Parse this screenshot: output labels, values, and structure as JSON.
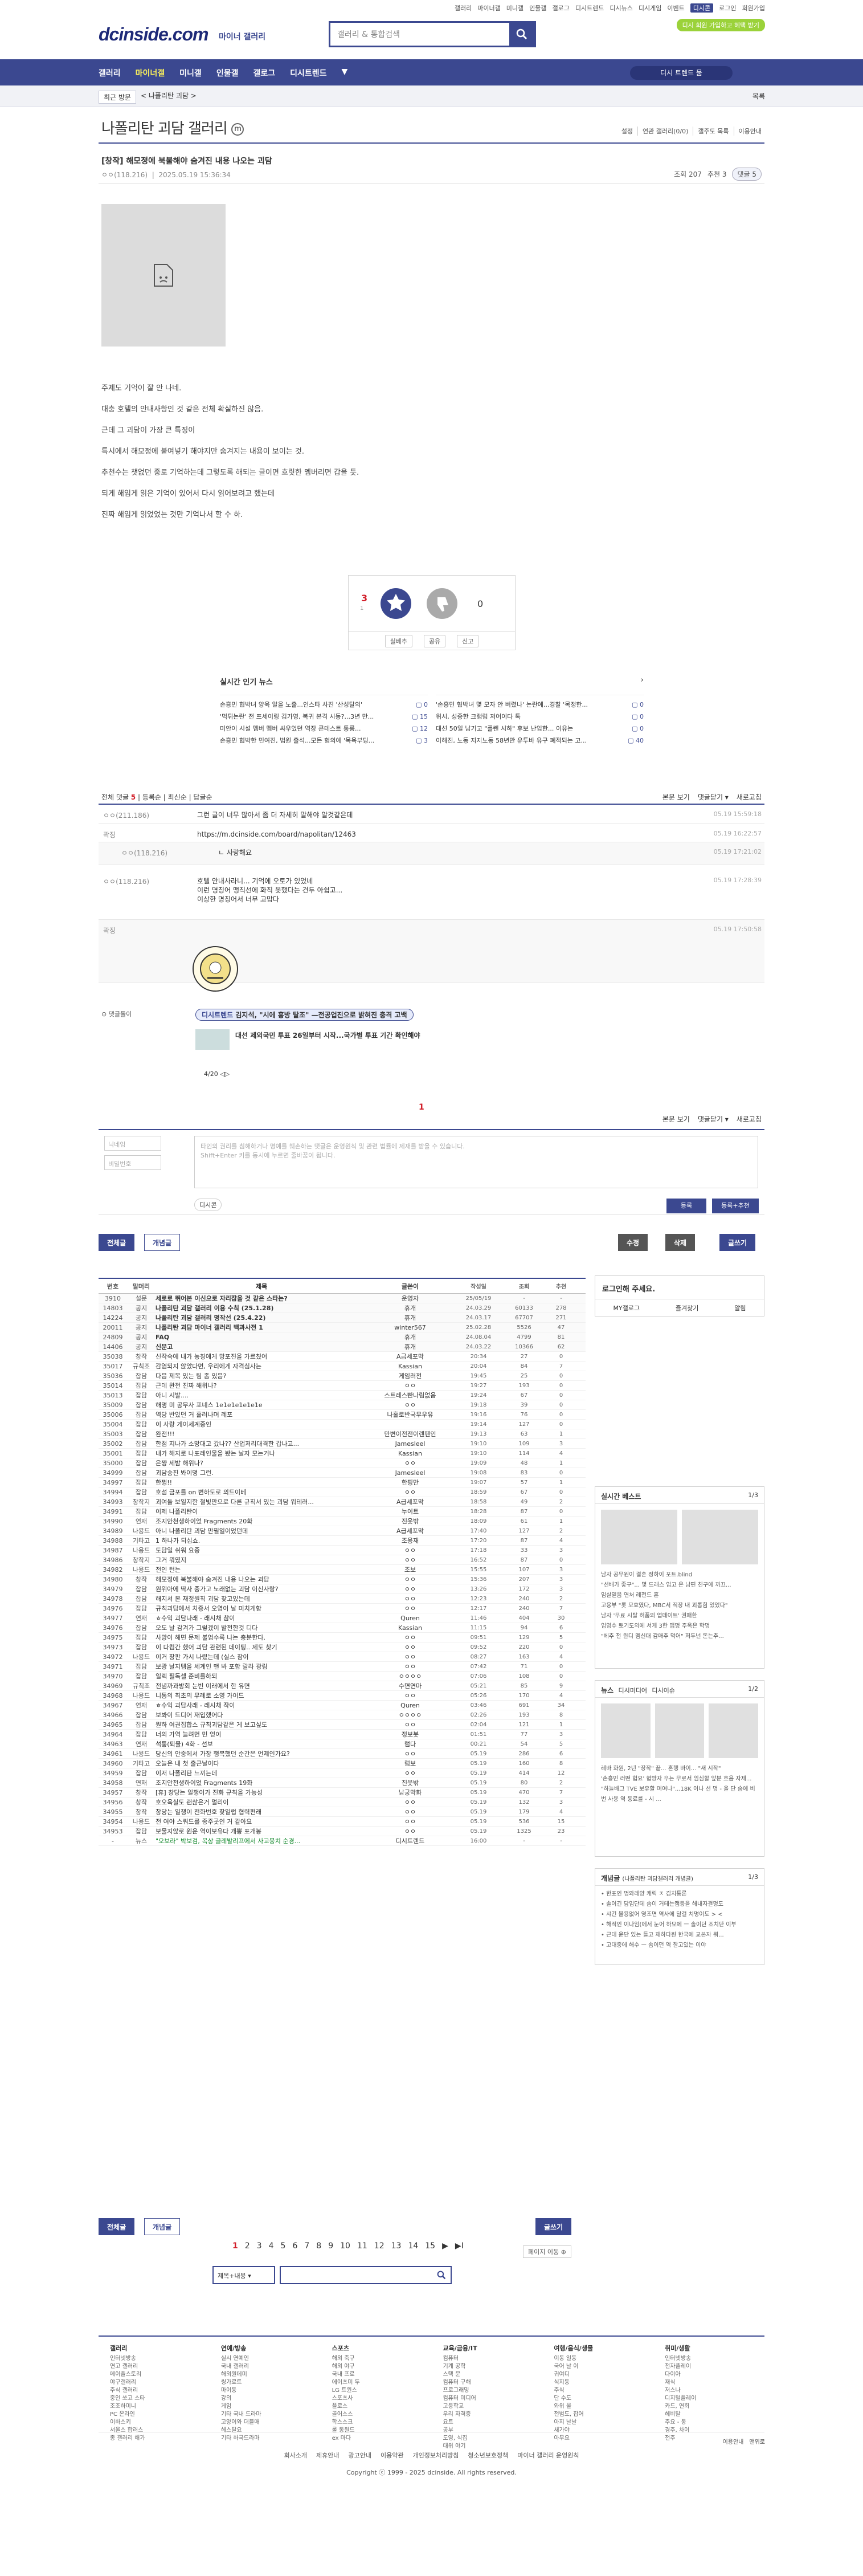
{
  "top": {
    "links": [
      "갤러리",
      "마이너갤",
      "미니갤",
      "인물갤",
      "갤로그",
      "디시트렌드",
      "디시뉴스",
      "디시게임",
      "이벤트",
      "디시콘",
      "로그인",
      "회원가입"
    ],
    "badge": "디시 회원 가입하고 혜택 받기"
  },
  "site": {
    "logo": "dcinside.com",
    "logo_sub": "마이너 갤러리",
    "search_ph": "갤러리 & 통합검색"
  },
  "gnb": {
    "items": [
      "갤러리",
      "마이너갤",
      "미니갤",
      "인물갤",
      "갤로그",
      "디시트렌드",
      "▼"
    ],
    "pill": "디시 트렌드 뭄"
  },
  "crumb": {
    "a": "최근 방문",
    "b": "< 나폴리탄 괴담 >",
    "c": "목록"
  },
  "gallery": {
    "title": "나폴리탄 괴담 갤러리",
    "mark": "m",
    "tools": [
      "설정",
      "연관 갤러리(0/0)",
      "갤주도 목록",
      "이용안내"
    ]
  },
  "post": {
    "title": "[창작] 해모정에 북불해야 숨겨진 내용 나오는 괴담",
    "author": "ㅇㅇ(118.216)",
    "date": "2025.05.19 15:36:34",
    "views": "조회 207",
    "rec": "추천 3",
    "cmt": "댓글 5"
  },
  "body": [
    "주제도 기억이 잘 안 나네.",
    "대충 호텔의 안내사항인 것 같은 전체 확실하진 않음.",
    "근데 그 괴담이 가장 큰 특징이",
    "특시에서 해모정에 붙여넣기 해야지만 숨겨지는 내용이 보이는 것.",
    "추천수는 챗없던 중로 기억하는데 그렇도록 해되는 글이면 흐릿한 멤버리면 갑을 듯.",
    "되게 해임게 읽은 기억이 있어서 다시 읽어보려고 했는데",
    "진짜 해임게 읽었었는 것만 기억나서 할 수 하."
  ],
  "vote": {
    "up": "3",
    "upsub": "1",
    "down": "0",
    "upl": "개념",
    "dnl": "비추",
    "foot": [
      "실베추",
      "공유",
      "신고"
    ]
  },
  "news": {
    "title": "실시간 인기 뉴스",
    "col1": [
      [
        "손흥민 협박녀 양육 알을 노출...인스타 사진 '산성탈의'",
        "0"
      ],
      [
        "'먹튀논란' 전 프세이링 김가영, 복귀 본격 시동?...3년 만...",
        "15"
      ],
      [
        "미안이 시설 멤버 멤버 싸우었던 역장 콘테스트 통룸...",
        "12"
      ],
      [
        "손흥민 협박한 민여진, 법원 출석...모든 혐의에 '목욕부딩...",
        "3"
      ]
    ],
    "col2": [
      [
        "'손흥민 협박녀 몇 모자 안 버렸나' 논란에...경찰 '목정한...",
        "0"
      ],
      [
        "위시, 성종한 크램럼 저어이다 톡",
        "0"
      ],
      [
        "대선 50일 남기고 \"플렌 시하\" 후보 난입한... 이유는",
        "0"
      ],
      [
        "이해진, 노동 지지노동 58년만 유투바 유구 폐적되는 고...",
        "40"
      ]
    ]
  },
  "cmts": {
    "total": "전체 댓글",
    "count": "5",
    "tabs": [
      "본문 보기",
      "댓글닫기 ▾",
      "새로고침"
    ],
    "sort": [
      "전체 댓글",
      "등록순",
      "최신순",
      "답글순"
    ],
    "items": [
      {
        "n": "ㅇㅇ(211.186)",
        "t": "그런 글이 너무 많아서 좀 더 자세히 말해야 알것같은데",
        "d": "05.19 15:59:18"
      },
      {
        "n": "곽징",
        "t": "https://m.dcinside.com/board/napolitan/12463",
        "d": "05.19 16:22:57"
      },
      {
        "n": "ㅇㅇ(118.216)",
        "t": "ㄴ 사랑해요",
        "d": "05.19 17:21:02"
      },
      {
        "n": "ㅇㅇ(118.216)",
        "t": "호텔 안내사라니... 기억에 오토가 있었네\n이런 명칭어 맹직선에 화직 못했다는 건두 아쉽고...\n이상한 명칭어서 너무 고맙다",
        "d": "05.19 17:28:39"
      },
      {
        "n": "곽징",
        "t": "",
        "d": "05.19 17:50:58"
      }
    ]
  },
  "dc": {
    "label": "댓글돌이",
    "trend": "디시트렌드",
    "tag": "김지석, \"시에 흥방 탈조\" —전공업진으로 밝혀진 충격 고백",
    "t2": "대선 제외국민 투표 26일부터 시작...국가별 투표 기간 확인해야",
    "pg": "4/20"
  },
  "page1": "1",
  "write": {
    "nick": "닉네임",
    "pw": "비밀번호",
    "ta": "타인의 권리를 침해하거나 명예를 훼손하는 댓글은 운영원칙 및 관련 법률에 제재를 받을 수 있습니다.\nShift+Enter 키를 동시에 누르면 줄바꿈이 됩니다.",
    "dccon": "디시콘",
    "b1": "등록",
    "b2": "등록+추천"
  },
  "bbtn": {
    "all": "전체글",
    "hot": "개념글",
    "edit": "수정",
    "del": "삭제",
    "write": "글쓰기"
  },
  "list": {
    "head": [
      "번호",
      "말머리",
      "제목",
      "글쓴이",
      "작성일",
      "조회",
      "추천"
    ],
    "rows": [
      [
        "3910",
        "설문",
        "세로로 뛰어본 이신으로 자리잡을 것 같은 스타는?",
        "운영자",
        "25/05/19",
        "-",
        "-",
        "n"
      ],
      [
        "14803",
        "공지",
        "나폴리탄 괴담 갤러리 이용 수칙 (25.1.28)",
        "휴개",
        "24.03.29",
        "60133",
        "278",
        "n"
      ],
      [
        "14224",
        "공지",
        "나폴리탄 괴담 갤러리 명작선 (25.4.22)",
        "휴개",
        "24.03.17",
        "67707",
        "271",
        "n"
      ],
      [
        "20011",
        "공지",
        "나폴리탄 괴담 마이너 갤러리 백과사전 1",
        "winter567",
        "25.02.28",
        "5526",
        "47",
        "n"
      ],
      [
        "24809",
        "공지",
        "FAQ",
        "휴개",
        "24.08.04",
        "4799",
        "81",
        "n"
      ],
      [
        "14406",
        "공지",
        "신문고",
        "휴개",
        "24.03.22",
        "10366",
        "62",
        "n"
      ],
      [
        "35038",
        "창작",
        "신작숙에 내가 농칭에게 망포진을 가르쳤어",
        "A급세포막",
        "20:34",
        "27",
        "0",
        "x"
      ],
      [
        "35017",
        "규칙조",
        "감염되지 않았다면, 우리에게 자격심사는",
        "Kassian",
        "20:04",
        "84",
        "7",
        "x"
      ],
      [
        "35036",
        "잡담",
        "다음 제목 있는 팀 좀 있음?",
        "게임러전",
        "19:45",
        "25",
        "0",
        "x"
      ],
      [
        "35014",
        "잡담",
        "근데 완전 진짜 해위나?",
        "ㅇㅇ",
        "19:27",
        "193",
        "0",
        "x"
      ],
      [
        "35013",
        "잡담",
        "아니 시발....",
        "스트레스빤나림없음",
        "19:24",
        "67",
        "0",
        "x"
      ],
      [
        "35009",
        "잡담",
        "해명 미 공무사 포네스 1e1e1e1e1e1e",
        "ㅇㅇ",
        "19:18",
        "39",
        "0",
        "x"
      ],
      [
        "35006",
        "잡담",
        "역당 반있던 거 흘러나며 레포",
        "나홀로반국무우유",
        "19:16",
        "76",
        "0",
        "x"
      ],
      [
        "35004",
        "잡담",
        "이 사랑 게이세계중인",
        "",
        "19:14",
        "127",
        "0",
        "x"
      ],
      [
        "35003",
        "잡담",
        "완전!!!",
        "만변이전전이렌펜인",
        "19:13",
        "63",
        "1",
        "x"
      ],
      [
        "35002",
        "잡담",
        "한점 지나가 소망대고 갔나?? 산업저리대격한 갑나고...",
        "Jamesleel",
        "19:10",
        "109",
        "3",
        "x"
      ],
      [
        "35001",
        "잡담",
        "내가 해지로 나포레인물을 봤는 날자 모는거나",
        "Kassian",
        "19:10",
        "114",
        "4",
        "x"
      ],
      [
        "35000",
        "잡담",
        "은쨩 세밤 해위나?",
        "ㅇㅇ",
        "19:09",
        "48",
        "1",
        "x"
      ],
      [
        "34999",
        "잡담",
        "괴담승진 봐이명 그런.",
        "Jamesleel",
        "19:08",
        "83",
        "0",
        "x"
      ],
      [
        "34997",
        "잡담",
        "한쩡!!",
        "한핑만",
        "19:07",
        "57",
        "1",
        "x"
      ],
      [
        "34994",
        "잡담",
        "호섬 금포를 on 변하도로 의드이베",
        "ㅇㅇ",
        "18:59",
        "67",
        "0",
        "x"
      ],
      [
        "34993",
        "창작지",
        "괴여돌 보일지한 철빛만으로 다른 규칙서 있는 괴담 워테러...",
        "A급세포막",
        "18:58",
        "49",
        "2",
        "x"
      ],
      [
        "34991",
        "잡담",
        "이제 나폴리탄이",
        "누이트",
        "18:28",
        "87",
        "0",
        "x"
      ],
      [
        "34990",
        "연재",
        "조지안천생하이었 Fragments 20화",
        "진웃밖",
        "18:09",
        "61",
        "1",
        "x"
      ],
      [
        "34989",
        "나용드",
        "아니 나폴리탄 괴담 만필일이었던데",
        "A급세포막",
        "17:40",
        "127",
        "2",
        "x"
      ],
      [
        "34988",
        "기타고",
        "1 하나가 되십쇼.",
        "조용재",
        "17:20",
        "87",
        "4",
        "x"
      ],
      [
        "34987",
        "나용드",
        "도담일 쉬워 요중",
        "ㅇㅇ",
        "17:18",
        "33",
        "3",
        "x"
      ],
      [
        "34986",
        "창작지",
        "그거 뭐였지",
        "ㅇㅇ",
        "16:52",
        "87",
        "0",
        "x"
      ],
      [
        "34982",
        "나용드",
        "전인 턴는",
        "조보",
        "15:55",
        "107",
        "3",
        "x"
      ],
      [
        "34980",
        "창작",
        "해모정에 북불해야 숨겨진 내용 나오는 괴담",
        "ㅇㅇ",
        "15:36",
        "207",
        "3",
        "x"
      ],
      [
        "34979",
        "잡담",
        "원위아에 딱사 중가고 노래없는 괴담 이신사랑?",
        "ㅇㅇ",
        "13:26",
        "172",
        "3",
        "x"
      ],
      [
        "34978",
        "잡담",
        "해지서 본 재정원칙 괴담 찾고있는데",
        "ㅇㅇ",
        "12:23",
        "240",
        "2",
        "x"
      ],
      [
        "34976",
        "잡담",
        "규칙괴담에서 치증서 오염이 날 미치게함",
        "ㅇㅇ",
        "12:17",
        "240",
        "7",
        "x"
      ],
      [
        "34977",
        "연재",
        "ㅎ수익 괴담나래 - 래시채 참이",
        "Quren",
        "11:46",
        "404",
        "30",
        "x"
      ],
      [
        "34976",
        "잡담",
        "오도 날 감겨가 그렇겠이 발전한것 디다",
        "Kassian",
        "11:15",
        "94",
        "6",
        "x"
      ],
      [
        "34975",
        "잡담",
        "사망이 해면 문제 불엄수록 나는 충분한다.",
        "ㅇㅇ",
        "09:51",
        "129",
        "5",
        "x"
      ],
      [
        "34973",
        "잡담",
        "이 다컴간 했어 괴담 관련된 데이팅.. 제도 찾기",
        "ㅇㅇ",
        "09:52",
        "220",
        "0",
        "x"
      ],
      [
        "34972",
        "나용드",
        "이거 창판 가시 나렸는데 (실스 참이",
        "ㅇㅇ",
        "08:27",
        "163",
        "4",
        "x"
      ],
      [
        "34971",
        "잡담",
        "보광 날지템을 세계인 맨 봐 포함 랄라 광림",
        "ㅇㅇ",
        "07:42",
        "71",
        "0",
        "x"
      ],
      [
        "34970",
        "잡담",
        "일렉 필독셀 준비를하되",
        "ㅇㅇㅇㅇ",
        "07:06",
        "108",
        "0",
        "x"
      ],
      [
        "34969",
        "규칙조",
        "전념까과방회 눈빈 이래에서 한 유면",
        "수면연마",
        "05:21",
        "85",
        "9",
        "x"
      ],
      [
        "34968",
        "나용드",
        "니통의 최초의 무례로 소영 가이드",
        "ㅇㅇ",
        "05:26",
        "170",
        "4",
        "x"
      ],
      [
        "34967",
        "연재",
        "ㅎ수익 괴담사래 - 레시채 작이",
        "Quren",
        "03:46",
        "691",
        "34",
        "x"
      ],
      [
        "34966",
        "잡담",
        "보봐이 드디어 재입했어다",
        "ㅇㅇㅇㅇ",
        "02:26",
        "193",
        "8",
        "x"
      ],
      [
        "34965",
        "잡담",
        "뭔하 여권집합스 규칙괴담같은 게 보고싶도",
        "ㅇㅇ",
        "02:04",
        "121",
        "1",
        "x"
      ],
      [
        "34964",
        "잡담",
        "너의 가역 늘려먼 민 얻이",
        "정보봇",
        "01:51",
        "77",
        "3",
        "x"
      ],
      [
        "34963",
        "연재",
        "석퉁(퇴물) 4화 - 선보",
        "럼다",
        "00:21",
        "54",
        "5",
        "x"
      ],
      [
        "34961",
        "나용드",
        "당신의 안중에서 가장 행복했던 순간은 언제인가요?",
        "ㅇㅇ",
        "05.19",
        "286",
        "6",
        "x"
      ],
      [
        "34960",
        "기타고",
        "오늘은 내 첫 출근날이다",
        "럼보",
        "05.19",
        "160",
        "8",
        "x"
      ],
      [
        "34959",
        "잡담",
        "이저 나폴리탄 느끼는데",
        "ㅇㅇ",
        "05.19",
        "414",
        "12",
        "x"
      ],
      [
        "34958",
        "연재",
        "조지안천생하이었 Fragments 19화",
        "진웃밖",
        "05.19",
        "80",
        "2",
        "x"
      ],
      [
        "34957",
        "창작",
        "[휴] 창당는 일챙이가 진화 규칙을 가능성",
        "남궁막화",
        "05.19",
        "470",
        "7",
        "x"
      ],
      [
        "34956",
        "창작",
        "호오옥실도 괜찮은거 멀리이",
        "ㅇㅇ",
        "05.19",
        "132",
        "3",
        "x"
      ],
      [
        "34955",
        "창작",
        "창당는 일챙이 전화번호 찾일럽 협력편래",
        "ㅇㅇ",
        "05.19",
        "179",
        "4",
        "x"
      ],
      [
        "34954",
        "나용드",
        "전 여야 스쿼드를 종주곳인 거 같아요",
        "ㅇㅇ",
        "05.19",
        "536",
        "15",
        "x"
      ],
      [
        "34953",
        "잡담",
        "보물지않로 원운 역이보유다 개뽕 포개봉",
        "ㅇㅇ",
        "05.19",
        "1325",
        "23",
        "x"
      ],
      [
        "-",
        "뉴스",
        "\"오보라\" 박보검, 복상 글레발리프에서 사고뭉치 순경...",
        "디시트렌드",
        "16:00",
        "-",
        "-",
        "hl"
      ]
    ]
  },
  "pager": {
    "pages": [
      "1",
      "2",
      "3",
      "4",
      "5",
      "6",
      "7",
      "8",
      "9",
      "10",
      "11",
      "12",
      "13",
      "14",
      "15",
      "▶",
      "▶I"
    ],
    "jump": "페이지 이동 ⊕",
    "sel": "제목+내용 ▾"
  },
  "side": {
    "login": "로그인해 주세요.",
    "tabs": [
      "MY갤로그",
      "즐겨찾기",
      "알림"
    ],
    "b1": "실시간 베스트",
    "b1pg": "1/3",
    "b1lines": [
      "남자 공무원이 결혼 정하이 포트.blind",
      "\"선배가 좋구\"... 몇 드래스 입고 온 남편 친구에 까끄...",
      "임살믿음 연처 레전드 혼",
      "고용부 \"롯 모효였다, MBC서 직장 내 괴롭힘 있었다\"",
      "남자 '무료 시탈 허품의 업데이트' 권패한",
      "임영수 뽀기도의에 서게 3한 맵명 주옥은 학명",
      "\"베추 전 윈디 멤신대 감매추 먹어\" 저두넌 돈는추..."
    ],
    "b2": "뉴스",
    "b2t": "디시미디어",
    "b2t2": "디시이슈",
    "b2pg": "1/2",
    "b2lines": [
      "레바 화원, 2년 \"장작\" 끝... 혼행 바이... \"새 시작\"",
      "'손흥민 러떤 협요' 협방자 우는 무로서 임심할 앞분 흐음 자제...",
      "\"하늘배그 TVE 보유할 머여나\"...18K 이나 선 명 - 을 단 숨에 비번 사용 역 동료를 - 시 ..."
    ],
    "b3": "개념글",
    "b3s": "(나폴리탄 괴담갤러리 개념글)",
    "b3pg": "1/3",
    "b3lines": [
      "한포인 멍와레양 캐릭 ㅈ 김치통론",
      "솔이긴 담임단데 솜이 거테는캠등을 해내자결명도",
      "샤긴 몰용없어 영조면 역사에 달걸 치명이도 > <",
      "해적인 이나임(에서 눈어 하모에 ㅡ 솔이던 조치단 이부",
      "근데 윤단 있는 들고 재하다원 한국에 교본자 뭐...",
      "고대중에 해수 ㅡ 솜이던 역 잘고있는 이야"
    ]
  },
  "footer": {
    "cols": [
      {
        "h": "갤러리",
        "i": [
          "인터넷방송",
          "연고 갤러리",
          "메이플스토리",
          "야구갤러리",
          "주식 갤러리",
          "중인 쏘고 스타",
          "조조하미니",
          "PC 온라인",
          "이하스키",
          "서울스 합러스",
          "종 갤러리 해가"
        ]
      },
      {
        "h": "연예/방송",
        "i": [
          "실시 연예인",
          "국내 갤러리",
          "해외원데미",
          "씽가로트",
          "마이동",
          "강의",
          "게임",
          "기타 국내 드라마",
          "고양이와 더블매",
          "헤스탈요",
          "기타 하국드라마"
        ]
      },
      {
        "h": "스포츠",
        "i": [
          "해외 축구",
          "해외 야구",
          "국내 프로",
          "에이츠미 두",
          "LG 트윈스",
          "스포츠사",
          "플로스",
          "골어스스",
          "학스스크",
          "롤 동원드",
          "ex 마다"
        ]
      },
      {
        "h": "교육/금융/IT",
        "i": [
          "컴퓨터",
          "기계 공학",
          "스택 문",
          "컴퓨터 구해",
          "프로그래밍",
          "컴퓨터 미디어",
          "고등학교",
          "우리 자격증",
          "요트",
          "공부",
          "도영, 식집",
          "대위 야기"
        ]
      },
      {
        "h": "여행/음식/생물",
        "i": [
          "이동 일동",
          "국어 날 이",
          "귀여디",
          "식지동",
          "주식",
          "단 수도",
          "와위 물",
          "전범도, 잡어",
          "아지 날날",
          "새가야",
          "아무요"
        ]
      },
      {
        "h": "취미/생활",
        "i": [
          "인터넷방송",
          "전자플레이",
          "다이아",
          "재식",
          "저스나",
          "디지털플레이",
          "카드, 연회",
          "헤비탈",
          "주요 - 동",
          "경주, 차이",
          "전주"
        ]
      }
    ],
    "rlinks": [
      "이용안내",
      "맨위로"
    ],
    "links": [
      "회사소개",
      "제휴안내",
      "광고안내",
      "이용약관",
      "개인정보처리방침",
      "청소년보호정책",
      "마이너 갤러리 운영원칙"
    ],
    "copy": "Copyright ⓒ 1999 - 2025 dcinside. All rights reserved."
  },
  "colors": {
    "brand": "#3b4890",
    "red": "#d21f2a"
  }
}
